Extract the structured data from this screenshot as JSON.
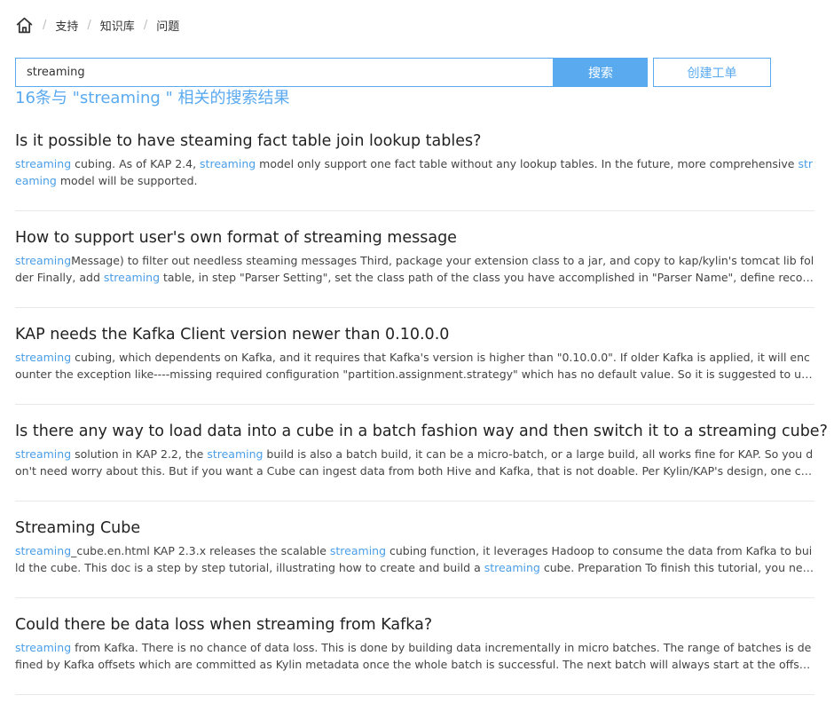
{
  "breadcrumb": {
    "home_icon": "home-icon",
    "items": [
      "支持",
      "知识库",
      "问题"
    ],
    "separator": "/"
  },
  "search": {
    "value": "streaming",
    "placeholder": "",
    "button_label": "搜索",
    "create_ticket_label": "创建工单"
  },
  "result_count": "16条与 \"streaming \" 相关的搜索结果",
  "colors": {
    "accent": "#5aaaf0",
    "highlight": "#4a9ee8",
    "text": "#333333",
    "divider": "#e8e8e8"
  },
  "results": [
    {
      "title": "Is it possible to have steaming fact table join lookup tables?",
      "snippet": [
        {
          "text": "streaming",
          "hl": true
        },
        {
          "text": " cubing. As of KAP 2.4, ",
          "hl": false
        },
        {
          "text": "streaming",
          "hl": true
        },
        {
          "text": " model only support one fact table without any lookup tables. In the future, more comprehensive ",
          "hl": false
        },
        {
          "text": "streaming",
          "hl": true
        },
        {
          "text": " model will be supported.",
          "hl": false
        }
      ]
    },
    {
      "title": "How to support user's own format of streaming message",
      "snippet": [
        {
          "text": "streaming",
          "hl": true
        },
        {
          "text": "Message) to filter out needless steaming messages Third, package your extension  class to a jar, and copy to kap/kylin's tomcat lib folder Finally, add ",
          "hl": false
        },
        {
          "text": "streaming",
          "hl": true
        },
        {
          "text": " table, in step \"Parser Setting\", set the class path of the class you have accomplished in \"Parser Name\", define record's timestamp",
          "hl": false
        }
      ]
    },
    {
      "title": "KAP needs the Kafka Client version newer than 0.10.0.0",
      "snippet": [
        {
          "text": "streaming",
          "hl": true
        },
        {
          "text": " cubing, which dependents on Kafka, and it requires that Kafka's version is higher than \"0.10.0.0\". If older Kafka is applied, it will encounter the exception like----missing required configuration \"partition.assignment.strategy\" which has no default value. So it is suggested to upgrade the Kafka",
          "hl": false
        }
      ]
    },
    {
      "title": "Is there any way to load data into a cube in a batch fashion way and then switch it to a streaming cube?",
      "snippet": [
        {
          "text": "streaming",
          "hl": true
        },
        {
          "text": " solution in KAP 2.2, the ",
          "hl": false
        },
        {
          "text": "streaming",
          "hl": true
        },
        {
          "text": " build is also a batch build, it can be a micro-batch, or a large build, all works fine for KAP. So you don't need worry about this. But if you want a Cube can ingest data from both Hive and Kafka, that is not doable. Per Kylin/KAP's design, one cube can only",
          "hl": false
        }
      ]
    },
    {
      "title": "Streaming Cube",
      "snippet": [
        {
          "text": "streaming",
          "hl": true
        },
        {
          "text": "_cube.en.html KAP 2.3.x releases the scalable ",
          "hl": false
        },
        {
          "text": "streaming",
          "hl": true
        },
        {
          "text": " cubing function, it leverages Hadoop to consume the data from Kafka to build the cube. This doc is a step by step tutorial, illustrating how to create and build a ",
          "hl": false
        },
        {
          "text": "streaming",
          "hl": true
        },
        {
          "text": " cube. Preparation To finish this tutorial, you need a Hadoop",
          "hl": false
        }
      ]
    },
    {
      "title": "Could there be data loss when streaming from Kafka?",
      "snippet": [
        {
          "text": "streaming",
          "hl": true
        },
        {
          "text": " from Kafka. There is no chance of data loss. This is done by building data incrementally in micro batches. The range of batches is defined by Kafka offsets which are committed as Kylin metadata once the whole batch is successful. The next batch will always start at the offset where the",
          "hl": false
        }
      ]
    }
  ]
}
